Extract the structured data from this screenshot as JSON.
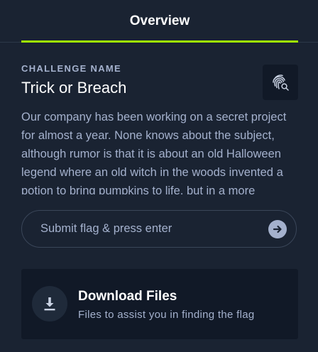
{
  "tabs": [
    {
      "label": "Overview",
      "active": true
    }
  ],
  "challenge": {
    "label": "CHALLENGE NAME",
    "name": "Trick or Breach",
    "description": "Our company has been working on a secret project for almost a year. None knows about the subject, although rumor is that it is about an old Halloween legend where an old witch in the woods invented a potion to bring pumpkins to life, but in a more wicked way."
  },
  "flag": {
    "placeholder": "Submit flag & press enter",
    "value": ""
  },
  "download": {
    "title": "Download Files",
    "subtitle": "Files to assist you in finding the flag"
  },
  "colors": {
    "background": "#1a2332",
    "panel": "#111927",
    "accent": "#9fef00",
    "muted_text": "#a4b1cd"
  },
  "icons": {
    "fingerprint": "fingerprint-search-icon",
    "submit": "arrow-right-circle-icon",
    "download": "download-icon"
  }
}
